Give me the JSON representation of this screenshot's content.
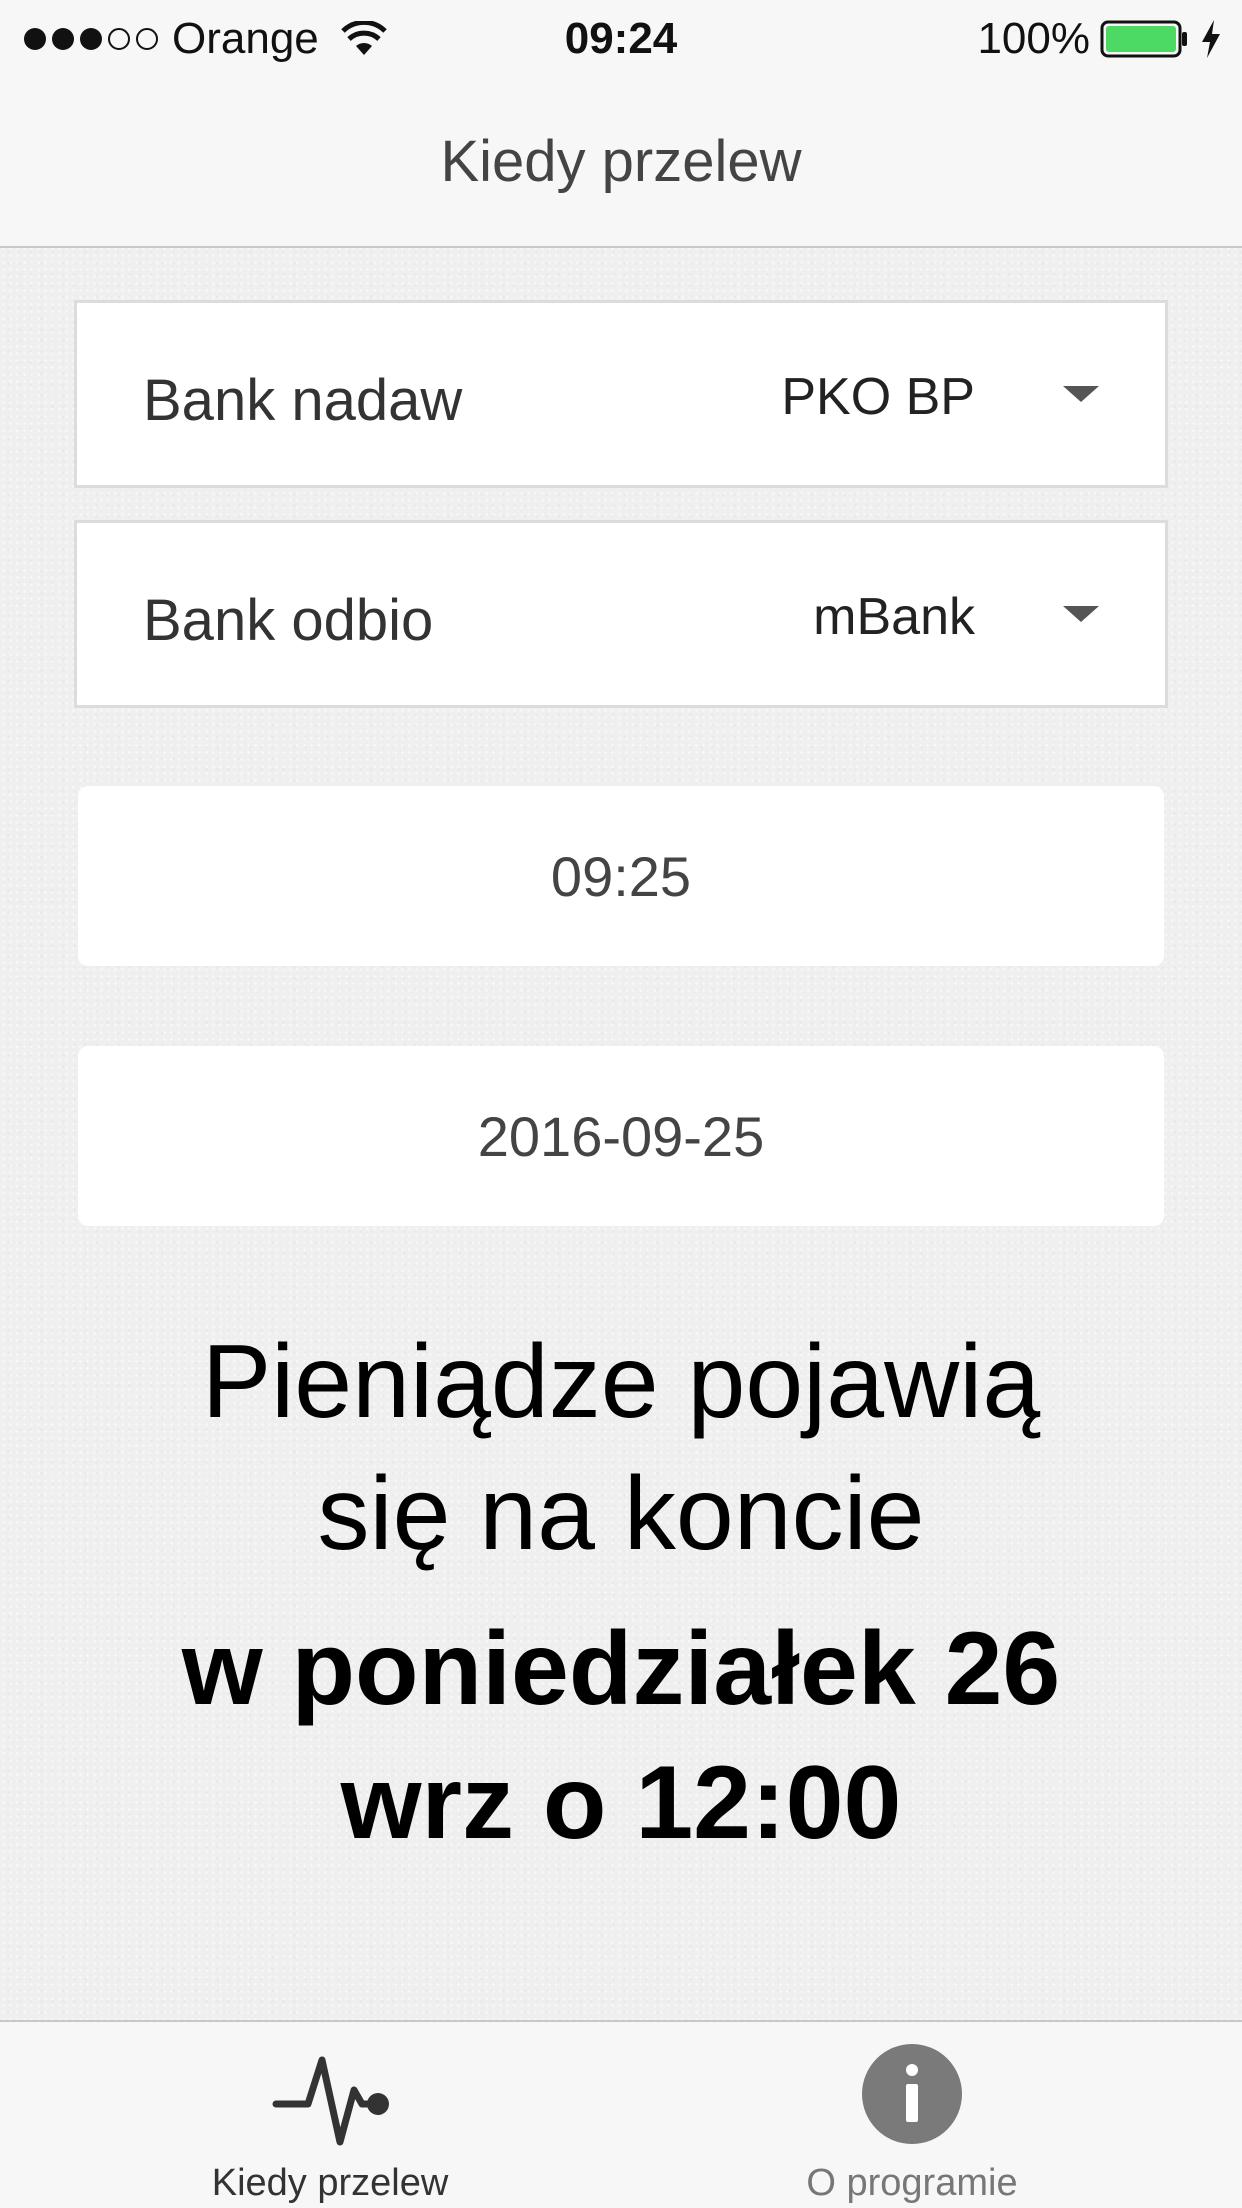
{
  "status_bar": {
    "carrier": "Orange",
    "time": "09:24",
    "battery": "100%",
    "signal_bars_filled": 3,
    "signal_bars_total": 5
  },
  "nav": {
    "title": "Kiedy przelew"
  },
  "form": {
    "sender_bank": {
      "label": "Bank nadaw",
      "value": "PKO BP"
    },
    "receiver_bank": {
      "label": "Bank odbio",
      "value": "mBank"
    },
    "time_value": "09:25",
    "date_value": "2016-09-25"
  },
  "result": {
    "line1": "Pieniądze pojawią",
    "line2": "się na koncie",
    "line3": "w poniedziałek 26",
    "line4": "wrz o 12:00"
  },
  "tabs": [
    {
      "label": "Kiedy przelew",
      "icon": "heartbeat-icon",
      "active": true
    },
    {
      "label": "O programie",
      "icon": "info-icon",
      "active": false
    }
  ],
  "colors": {
    "battery": "#4cd964",
    "tab_icon_active": "#333333",
    "tab_icon_inactive": "#7a7a7a"
  }
}
